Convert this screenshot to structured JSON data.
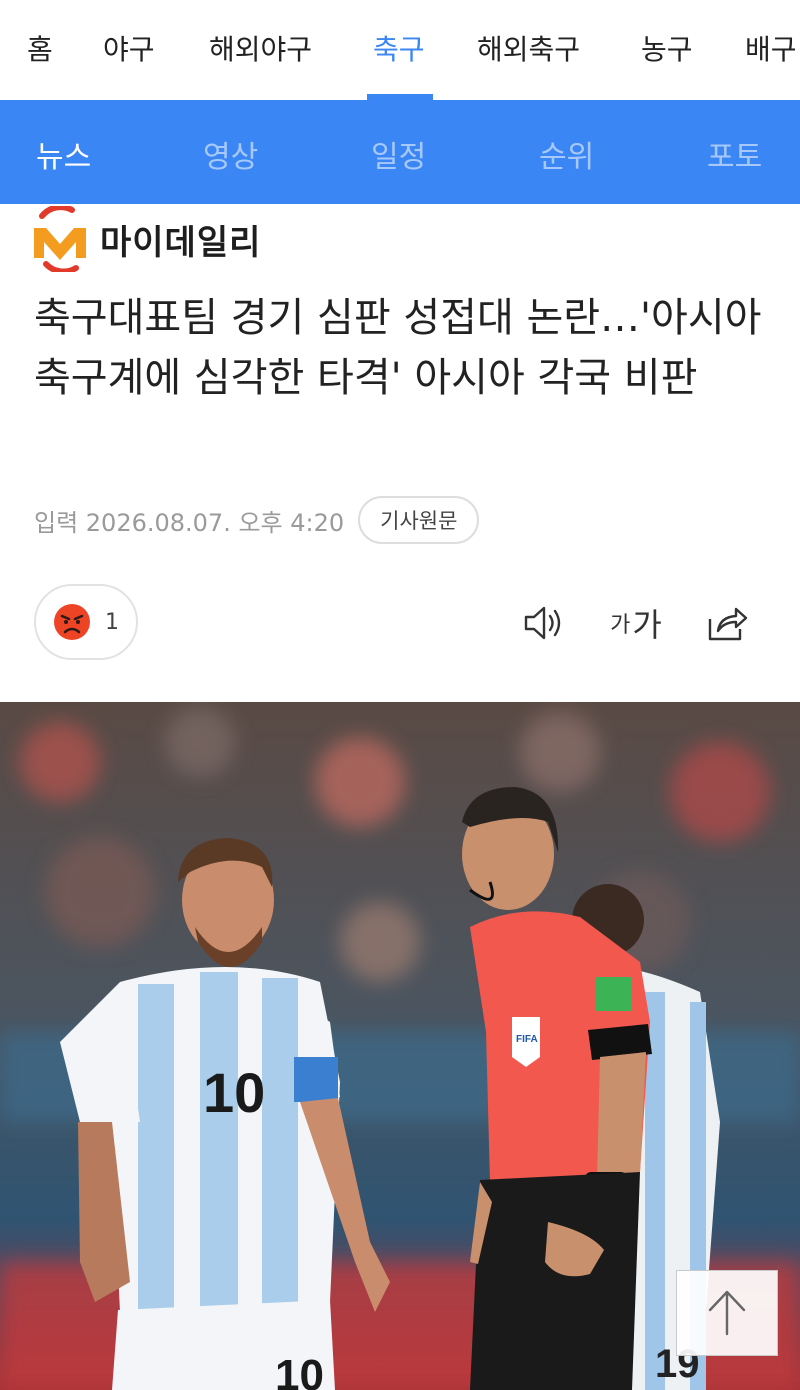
{
  "top_nav": {
    "tabs": [
      {
        "label": "홈"
      },
      {
        "label": "야구"
      },
      {
        "label": "해외야구"
      },
      {
        "label": "축구"
      },
      {
        "label": "해외축구"
      },
      {
        "label": "농구"
      },
      {
        "label": "배구"
      }
    ],
    "active_tab": "축구",
    "accent_color": "#3b86f5"
  },
  "sub_nav": {
    "tabs": [
      {
        "label": "뉴스"
      },
      {
        "label": "영상"
      },
      {
        "label": "일정"
      },
      {
        "label": "순위"
      },
      {
        "label": "포토"
      }
    ],
    "active_tab": "뉴스",
    "background_color": "#3b86f5"
  },
  "article": {
    "publisher": "마이데일리",
    "publisher_logo_icon": "mydaily-logo",
    "headline": "축구대표팀 경기 심판 성접대 논란…'아시아 축구계에 심각한 타격' 아시아 각국 비판",
    "timestamp": "입력 2026.08.07. 오후 4:20",
    "original_button": "기사원문",
    "reaction": {
      "icon": "angry-face-icon",
      "count": "1"
    },
    "toolbar": {
      "audio_icon": "speaker-icon",
      "font_small": "가",
      "font_large": "가",
      "share_icon": "share-icon"
    },
    "photo_icon": "soccer-match-photo"
  },
  "scroll_top_icon": "arrow-up-icon"
}
